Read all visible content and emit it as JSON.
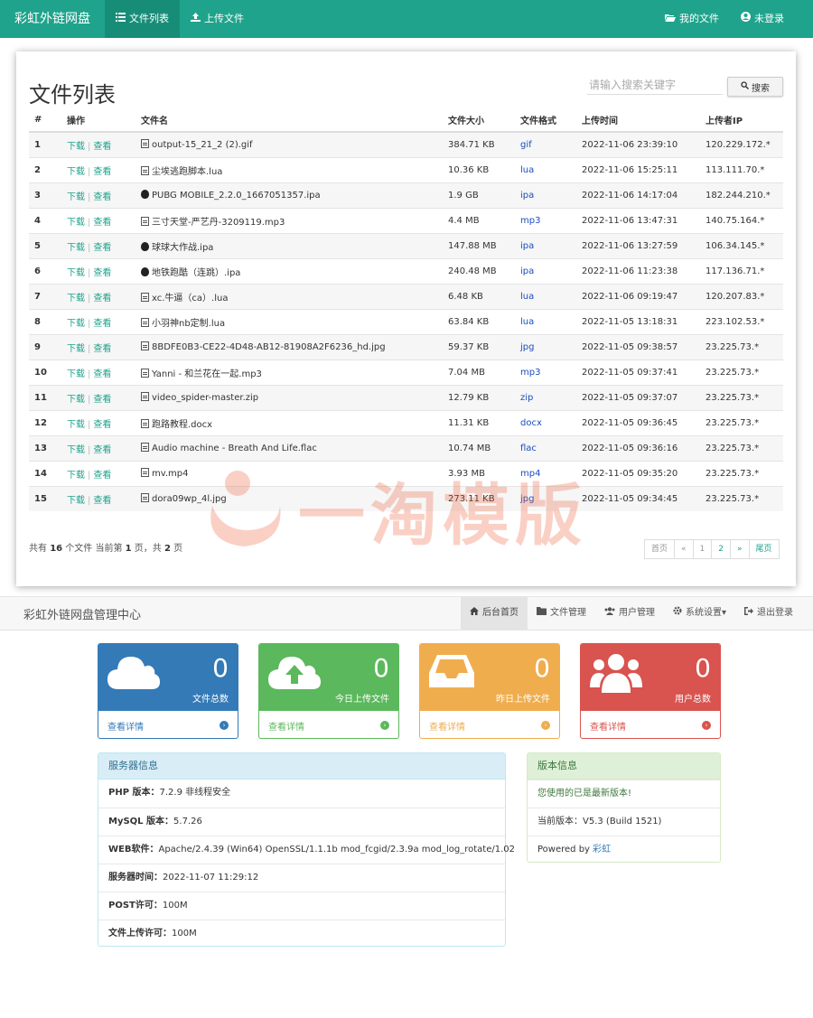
{
  "topbar": {
    "brand": "彩虹外链网盘",
    "nav": [
      {
        "label": "文件列表",
        "icon": "list-icon",
        "active": true
      },
      {
        "label": "上传文件",
        "icon": "upload-icon",
        "active": false
      }
    ],
    "right": [
      {
        "label": "我的文件",
        "icon": "folder-open-icon"
      },
      {
        "label": "未登录",
        "icon": "user-circle-icon"
      }
    ]
  },
  "filelist": {
    "title": "文件列表",
    "search_placeholder": "请输入搜索关键字",
    "search_button": "搜索",
    "columns": [
      "#",
      "操作",
      "文件名",
      "文件大小",
      "文件格式",
      "上传时间",
      "上传者IP"
    ],
    "action_download": "下载",
    "action_view": "查看",
    "rows": [
      {
        "idx": "1",
        "icon": "image",
        "name": "output-15_21_2 (2).gif",
        "size": "384.71 KB",
        "format": "gif",
        "time": "2022-11-06 23:39:10",
        "ip": "120.229.172.*"
      },
      {
        "idx": "2",
        "icon": "file",
        "name": "尘埃逃跑脚本.lua",
        "size": "10.36 KB",
        "format": "lua",
        "time": "2022-11-06 15:25:11",
        "ip": "113.111.70.*"
      },
      {
        "idx": "3",
        "icon": "apple",
        "name": "PUBG MOBILE_2.2.0_1667051357.ipa",
        "size": "1.9 GB",
        "format": "ipa",
        "time": "2022-11-06 14:17:04",
        "ip": "182.244.210.*"
      },
      {
        "idx": "4",
        "icon": "audio",
        "name": "三寸天堂-严艺丹-3209119.mp3",
        "size": "4.4 MB",
        "format": "mp3",
        "time": "2022-11-06 13:47:31",
        "ip": "140.75.164.*"
      },
      {
        "idx": "5",
        "icon": "apple",
        "name": "球球大作战.ipa",
        "size": "147.88 MB",
        "format": "ipa",
        "time": "2022-11-06 13:27:59",
        "ip": "106.34.145.*"
      },
      {
        "idx": "6",
        "icon": "apple",
        "name": "地铁跑酷（连跳）.ipa",
        "size": "240.48 MB",
        "format": "ipa",
        "time": "2022-11-06 11:23:38",
        "ip": "117.136.71.*"
      },
      {
        "idx": "7",
        "icon": "file",
        "name": "xc.牛逼（ca）.lua",
        "size": "6.48 KB",
        "format": "lua",
        "time": "2022-11-06 09:19:47",
        "ip": "120.207.83.*"
      },
      {
        "idx": "8",
        "icon": "file",
        "name": "小羽神nb定制.lua",
        "size": "63.84 KB",
        "format": "lua",
        "time": "2022-11-05 13:18:31",
        "ip": "223.102.53.*"
      },
      {
        "idx": "9",
        "icon": "image",
        "name": "8BDFE0B3-CE22-4D48-AB12-81908A2F6236_hd.jpg",
        "size": "59.37 KB",
        "format": "jpg",
        "time": "2022-11-05 09:38:57",
        "ip": "23.225.73.*"
      },
      {
        "idx": "10",
        "icon": "audio",
        "name": "Yanni - 和兰花在一起.mp3",
        "size": "7.04 MB",
        "format": "mp3",
        "time": "2022-11-05 09:37:41",
        "ip": "23.225.73.*"
      },
      {
        "idx": "11",
        "icon": "zip",
        "name": "video_spider-master.zip",
        "size": "12.79 KB",
        "format": "zip",
        "time": "2022-11-05 09:37:07",
        "ip": "23.225.73.*"
      },
      {
        "idx": "12",
        "icon": "file",
        "name": "跑路教程.docx",
        "size": "11.31 KB",
        "format": "docx",
        "time": "2022-11-05 09:36:45",
        "ip": "23.225.73.*"
      },
      {
        "idx": "13",
        "icon": "audio",
        "name": "Audio machine - Breath And Life.flac",
        "size": "10.74 MB",
        "format": "flac",
        "time": "2022-11-05 09:36:16",
        "ip": "23.225.73.*"
      },
      {
        "idx": "14",
        "icon": "video",
        "name": "mv.mp4",
        "size": "3.93 MB",
        "format": "mp4",
        "time": "2022-11-05 09:35:20",
        "ip": "23.225.73.*"
      },
      {
        "idx": "15",
        "icon": "image",
        "name": "dora09wp_4l.jpg",
        "size": "273.11 KB",
        "format": "jpg",
        "time": "2022-11-05 09:34:45",
        "ip": "23.225.73.*"
      }
    ],
    "pageinfo": {
      "p1": "共有 ",
      "total": "16",
      "p2": " 个文件   当前第 ",
      "current": "1",
      "p3": " 页，共 ",
      "pages": "2",
      "p4": " 页"
    },
    "pager": [
      "首页",
      "«",
      "1",
      "2",
      "»",
      "尾页"
    ]
  },
  "watermark": {
    "text": "一淘模版"
  },
  "admin": {
    "brand": "彩虹外链网盘管理中心",
    "nav": [
      {
        "label": "后台首页",
        "icon": "home-icon",
        "active": true
      },
      {
        "label": "文件管理",
        "icon": "folder-icon",
        "active": false
      },
      {
        "label": "用户管理",
        "icon": "users-icon",
        "active": false
      },
      {
        "label": "系统设置▾",
        "icon": "gear-icon",
        "active": false
      },
      {
        "label": "退出登录",
        "icon": "sign-out-icon",
        "active": false
      }
    ],
    "cards": [
      {
        "count": "0",
        "label": "文件总数",
        "link": "查看详情",
        "color": "#337ab7",
        "icon": "cloud-icon"
      },
      {
        "count": "0",
        "label": "今日上传文件",
        "link": "查看详情",
        "color": "#5cb85c",
        "icon": "cloud-upload-icon"
      },
      {
        "count": "0",
        "label": "昨日上传文件",
        "link": "查看详情",
        "color": "#f0ad4e",
        "icon": "inbox-icon"
      },
      {
        "count": "0",
        "label": "用户总数",
        "link": "查看详情",
        "color": "#d9534f",
        "icon": "users-icon"
      }
    ],
    "server": {
      "title": "服务器信息",
      "rows": [
        {
          "k": "PHP 版本：",
          "v": "7.2.9 非线程安全"
        },
        {
          "k": "MySQL 版本：",
          "v": "5.7.26"
        },
        {
          "k": "WEB软件：",
          "v": "Apache/2.4.39 (Win64) OpenSSL/1.1.1b mod_fcgid/2.3.9a mod_log_rotate/1.02"
        },
        {
          "k": "服务器时间：",
          "v": "2022-11-07 11:29:12"
        },
        {
          "k": "POST许可：",
          "v": "100M"
        },
        {
          "k": "文件上传许可：",
          "v": "100M"
        }
      ]
    },
    "version": {
      "title": "版本信息",
      "latest": "您使用的已是最新版本!",
      "current": "当前版本：V5.3 (Build 1521)",
      "powered_prefix": "Powered by ",
      "powered_link": "彩虹"
    }
  }
}
